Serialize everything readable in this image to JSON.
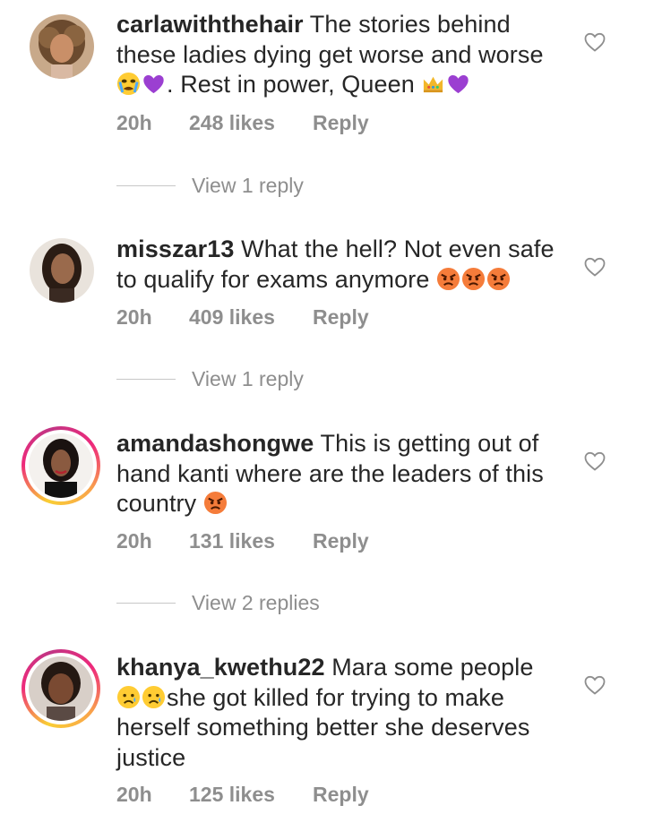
{
  "comments": [
    {
      "username": "carlawiththehair",
      "segments": [
        {
          "t": "The stories behind these ladies dying get worse and worse "
        },
        {
          "e": "crying"
        },
        {
          "e": "purple-heart"
        },
        {
          "t": ". Rest in power, Queen "
        },
        {
          "e": "crown"
        },
        {
          "e": "purple-heart"
        }
      ],
      "time": "20h",
      "likes": "248 likes",
      "reply": "Reply",
      "view_replies": "View 1 reply",
      "story_ring": false
    },
    {
      "username": "misszar13",
      "segments": [
        {
          "t": "What the hell? Not even safe to qualify for exams anymore "
        },
        {
          "e": "angry"
        },
        {
          "e": "angry"
        },
        {
          "e": "angry"
        }
      ],
      "time": "20h",
      "likes": "409 likes",
      "reply": "Reply",
      "view_replies": "View 1 reply",
      "story_ring": false
    },
    {
      "username": "amandashongwe",
      "segments": [
        {
          "t": "This is getting out of hand kanti where are the leaders of this country "
        },
        {
          "e": "angry"
        }
      ],
      "time": "20h",
      "likes": "131 likes",
      "reply": "Reply",
      "view_replies": "View 2 replies",
      "story_ring": true
    },
    {
      "username": "khanya_kwethu22",
      "segments": [
        {
          "t": "Mara some people "
        },
        {
          "e": "sad"
        },
        {
          "e": "sad"
        },
        {
          "t": "she got killed for trying to make herself something better she deserves justice"
        }
      ],
      "time": "20h",
      "likes": "125 likes",
      "reply": "Reply",
      "view_replies": "",
      "story_ring": true
    }
  ],
  "icons": {
    "like": "heart-outline-icon"
  },
  "colors": {
    "text": "#262626",
    "muted": "#8e8e8e",
    "divider": "#c7c7c7"
  }
}
